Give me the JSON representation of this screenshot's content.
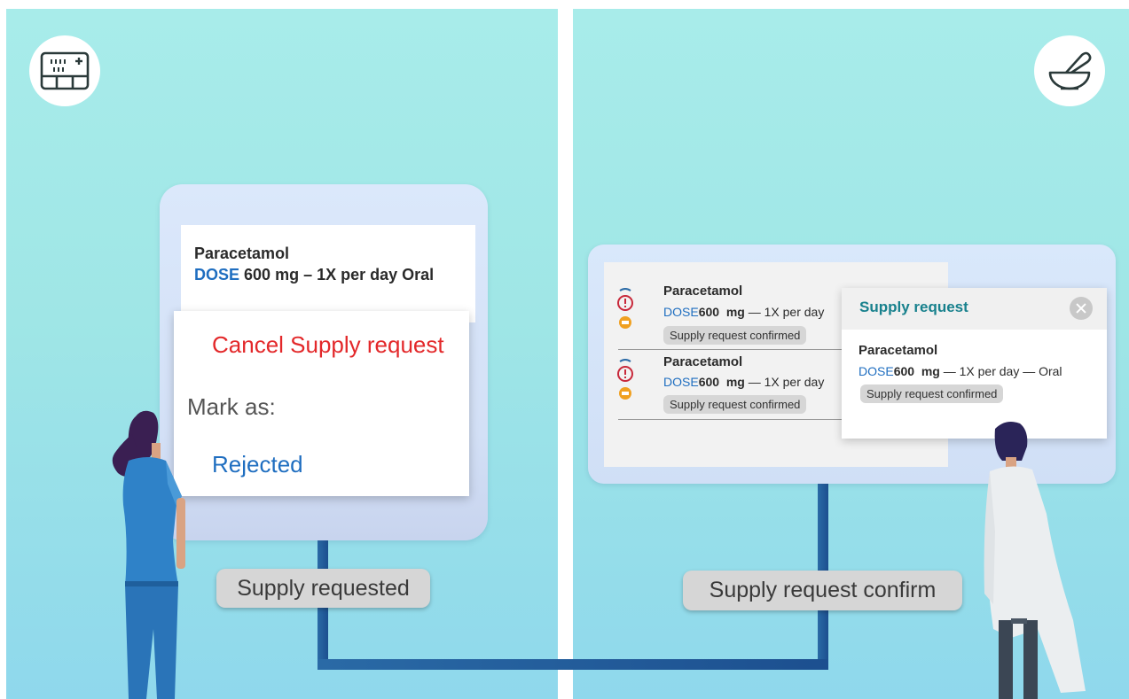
{
  "left_panel": {
    "role_icon": "hospital-ward-icon",
    "medication": {
      "name": "Paracetamol",
      "dose_keyword": "DOSE",
      "dose_text": "600 mg – 1X per day Oral"
    },
    "menu": {
      "cancel_label": "Cancel Supply request",
      "mark_as_label": "Mark as:",
      "rejected_label": "Rejected"
    },
    "status_label": "Supply requested"
  },
  "right_panel": {
    "role_icon": "mortar-pestle-icon",
    "list": [
      {
        "name": "Paracetamol",
        "dose_keyword": "DOSE",
        "dose_value": "600",
        "dose_unit": "mg",
        "dose_text": "— 1X per day",
        "chip": "Supply request confirmed"
      },
      {
        "name": "Paracetamol",
        "dose_keyword": "DOSE",
        "dose_value": "600",
        "dose_unit": "mg",
        "dose_text": "— 1X per day",
        "chip": "Supply request confirmed"
      }
    ],
    "popup": {
      "title": "Supply request",
      "name": "Paracetamol",
      "dose_keyword": "DOSE",
      "dose_value": "600",
      "dose_unit": "mg",
      "dose_text": "— 1X per day — Oral",
      "chip": "Supply request confirmed"
    },
    "status_label": "Supply request confirm"
  },
  "colors": {
    "background_teal": "#9fe6e6",
    "dose_blue": "#1f6ec0",
    "cancel_red": "#e3282a",
    "popup_title_teal": "#18818d",
    "connector_blue": "#2a6aa6"
  }
}
